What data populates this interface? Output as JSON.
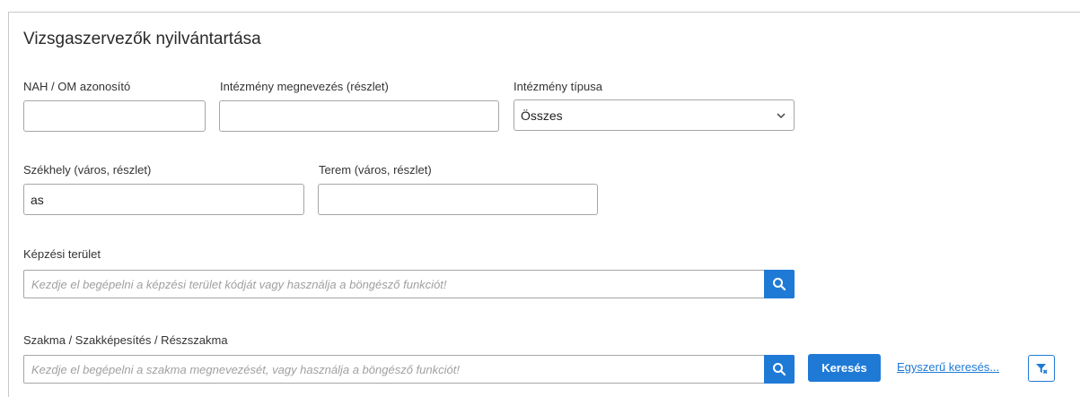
{
  "page": {
    "title": "Vizsgaszervezők nyilvántartása"
  },
  "fields": {
    "nah_om": {
      "label": "NAH / OM azonosító",
      "value": ""
    },
    "intezmeny_nev": {
      "label": "Intézmény megnevezés (részlet)",
      "value": ""
    },
    "intezmeny_tipus": {
      "label": "Intézmény típusa",
      "selected": "Összes"
    },
    "szekhely": {
      "label": "Székhely (város, részlet)",
      "value": "as"
    },
    "terem": {
      "label": "Terem (város, részlet)",
      "value": ""
    },
    "kepzesi_terulet": {
      "label": "Képzési terület",
      "placeholder": "Kezdje el begépelni a képzési terület kódját vagy használja a böngésző funkciót!"
    },
    "szakma": {
      "label": "Szakma / Szakképesítés / Részszakma",
      "placeholder": "Kezdje el begépelni a szakma megnevezését, vagy használja a böngésző funkciót!"
    }
  },
  "actions": {
    "search_label": "Keresés",
    "simple_search_label": "Egyszerű keresés..."
  },
  "icons": {
    "search": "search-icon",
    "chevron": "chevron-down-icon",
    "filter_clear": "filter-clear-icon"
  },
  "colors": {
    "accent": "#1f7ad6"
  }
}
